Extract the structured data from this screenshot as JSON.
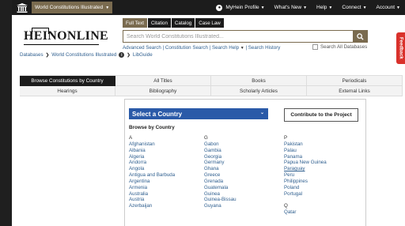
{
  "topbar": {
    "library_label": "World Constitutions Illustrated",
    "nav": [
      "MyHein Profile",
      "What's New",
      "Help",
      "Connect",
      "Account"
    ]
  },
  "logo": {
    "text": "HEINONLINE"
  },
  "search": {
    "tabs": [
      "Full Text",
      "Citation",
      "Catalog",
      "Case Law"
    ],
    "active_tab": "Full Text",
    "placeholder": "Search World Constitutions Illustrated...",
    "links": [
      "Advanced Search",
      "Constitution Search",
      "Search Help",
      "Search History"
    ],
    "search_all_label": "Search All Databases"
  },
  "feedback_label": "Feedback",
  "breadcrumb": [
    "Databases",
    "World Constitutions Illustrated",
    "LibGuide"
  ],
  "nav_grid": [
    "Browse Constitutions by Country",
    "All Titles",
    "Books",
    "Periodicals",
    "Hearings",
    "Bibliography",
    "Scholarly Articles",
    "External Links"
  ],
  "content": {
    "select_label": "Select a Country",
    "contribute_label": "Contribute to the Project",
    "browse_heading": "Browse by Country",
    "columns": [
      [
        {
          "letter": "A"
        },
        {
          "country": "Afghanistan"
        },
        {
          "country": "Albania"
        },
        {
          "country": "Algeria"
        },
        {
          "country": "Andorra"
        },
        {
          "country": "Angola"
        },
        {
          "country": "Antigua and Barbuda"
        },
        {
          "country": "Argentina"
        },
        {
          "country": "Armenia"
        },
        {
          "country": "Australia"
        },
        {
          "country": "Austria"
        },
        {
          "country": "Azerbaijan"
        }
      ],
      [
        {
          "letter": "G"
        },
        {
          "country": "Gabon"
        },
        {
          "country": "Gambia"
        },
        {
          "country": "Georgia"
        },
        {
          "country": "Germany"
        },
        {
          "country": "Ghana"
        },
        {
          "country": "Greece"
        },
        {
          "country": "Grenada"
        },
        {
          "country": "Guatemala"
        },
        {
          "country": "Guinea"
        },
        {
          "country": "Guinea-Bissau"
        },
        {
          "country": "Guyana"
        }
      ],
      [
        {
          "letter": "P"
        },
        {
          "country": "Pakistan"
        },
        {
          "country": "Palau"
        },
        {
          "country": "Panama"
        },
        {
          "country": "Papua New Guinea"
        },
        {
          "country": "Paraguay",
          "underlined": true
        },
        {
          "country": "Peru"
        },
        {
          "country": "Philippines"
        },
        {
          "country": "Poland"
        },
        {
          "country": "Portugal"
        },
        {
          "gap": true
        },
        {
          "letter": "Q"
        },
        {
          "country": "Qatar"
        }
      ]
    ]
  }
}
